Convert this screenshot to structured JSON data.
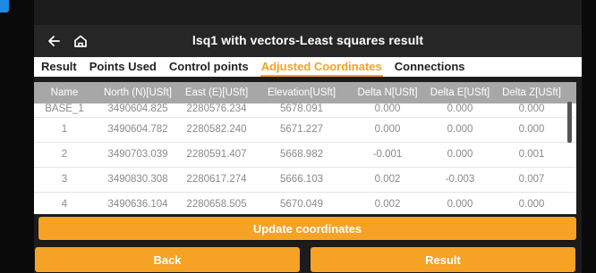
{
  "colors": {
    "accent": "#f6a225",
    "header_bg": "#a7a7a7",
    "app_bar": "#262626",
    "text_gray": "#8a8a8a"
  },
  "appbar": {
    "title": "lsq1 with vectors-Least squares result",
    "back_icon": "arrow-left-icon",
    "home_icon": "home-icon"
  },
  "tabs": [
    {
      "label": "Result"
    },
    {
      "label": "Points Used"
    },
    {
      "label": "Control points"
    },
    {
      "label": "Adjusted Coordinates",
      "active": true
    },
    {
      "label": "Connections"
    }
  ],
  "table": {
    "columns": [
      "Name",
      "North (N)[USft]",
      "East (E)[USft]",
      "Elevation[USft]",
      "Delta N[USft]",
      "Delta E[USft]",
      "Delta Z[USft]"
    ],
    "rows": [
      [
        "BASE_1",
        "3490604.825",
        "2280576.234",
        "5678.091",
        "0.000",
        "0.000",
        "0.000"
      ],
      [
        "1",
        "3490604.782",
        "2280582.240",
        "5671.227",
        "0.000",
        "0.000",
        "0.000"
      ],
      [
        "2",
        "3490703.039",
        "2280591.407",
        "5668.982",
        "-0.001",
        "0.000",
        "0.001"
      ],
      [
        "3",
        "3490830.308",
        "2280617.274",
        "5666.103",
        "0.002",
        "-0.003",
        "0.007"
      ],
      [
        "4",
        "3490636.104",
        "2280658.505",
        "5670.049",
        "0.002",
        "0.000",
        "0.000"
      ]
    ]
  },
  "buttons": {
    "update": "Update coordinates",
    "back": "Back",
    "result": "Result"
  }
}
